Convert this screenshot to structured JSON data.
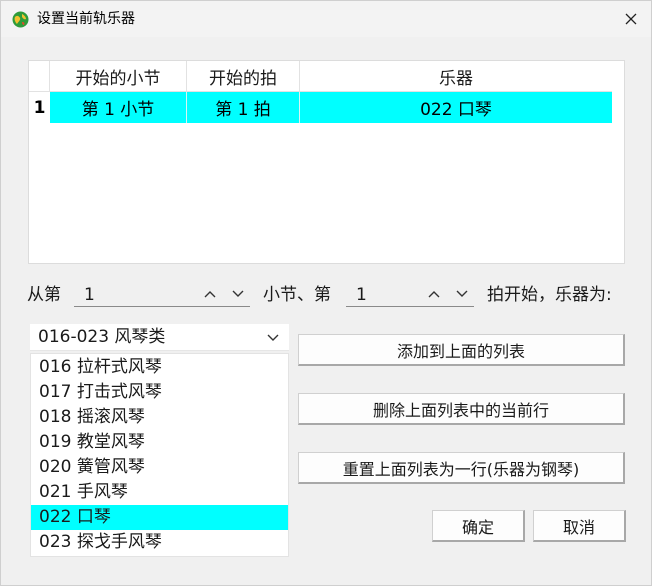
{
  "window": {
    "title": "设置当前轨乐器"
  },
  "table": {
    "headers": [
      "开始的小节",
      "开始的拍",
      "乐器"
    ],
    "rows": [
      {
        "row_num": "1",
        "measure": "第 1 小节",
        "beat": "第 1 拍",
        "instrument": "022 口琴"
      }
    ]
  },
  "from_row": {
    "label_from": "从第",
    "measure_value": "1",
    "label_measure": "小节、第",
    "beat_value": "1",
    "label_start": "拍开始，乐器为:"
  },
  "category_combo": {
    "value": "016-023 风琴类"
  },
  "instrument_list": {
    "items": [
      "016 拉杆式风琴",
      "017 打击式风琴",
      "018 摇滚风琴",
      "019 教堂风琴",
      "020 簧管风琴",
      "021 手风琴",
      "022 口琴",
      "023 探戈手风琴"
    ],
    "selected_index": 6
  },
  "buttons": {
    "add": "添加到上面的列表",
    "delete": "删除上面列表中的当前行",
    "reset": "重置上面列表为一行(乐器为钢琴)",
    "ok": "确定",
    "cancel": "取消"
  },
  "colors": {
    "selection": "#00ffff",
    "window_bg": "#f0f0f0"
  },
  "icons": {
    "app": "globe-icon",
    "close": "close-icon"
  }
}
